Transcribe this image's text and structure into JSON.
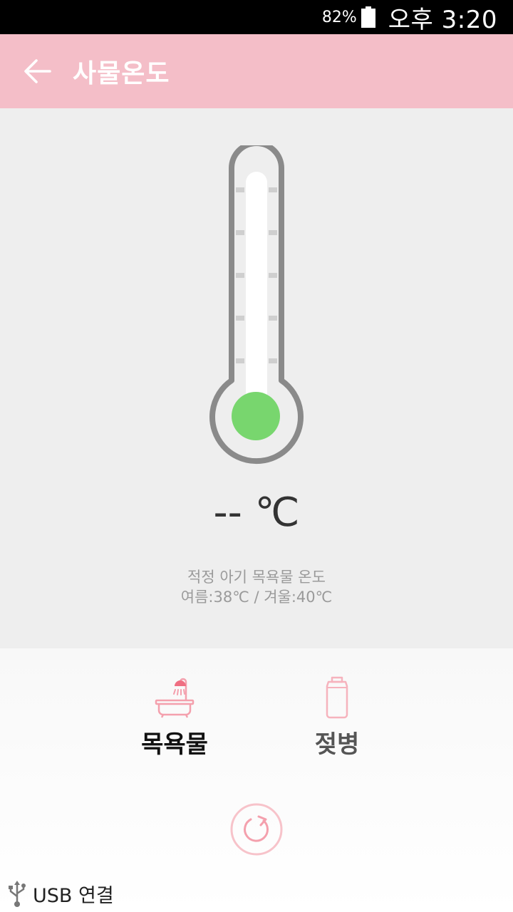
{
  "status_bar": {
    "battery": "82%",
    "time": "오후 3:20"
  },
  "app_bar": {
    "title": "사물온도"
  },
  "reading": {
    "temperature": "-- ℃"
  },
  "hint": {
    "line1": "적정 아기 목욕물 온도",
    "line2": "여름:38℃ / 겨울:40℃"
  },
  "modes": [
    {
      "label": "목욕물",
      "icon": "bathtub-icon",
      "selected": true
    },
    {
      "label": "젖병",
      "icon": "baby-bottle-icon",
      "selected": false
    }
  ],
  "notification": {
    "usb_label": "USB 연결"
  },
  "colors": {
    "app_bar": "#f4bec8",
    "accent_pink": "#f4a0ad",
    "thermometer_bulb": "#78d66e",
    "thermometer_outline": "#8a8a8a",
    "panel_bg": "#eeeeee"
  }
}
